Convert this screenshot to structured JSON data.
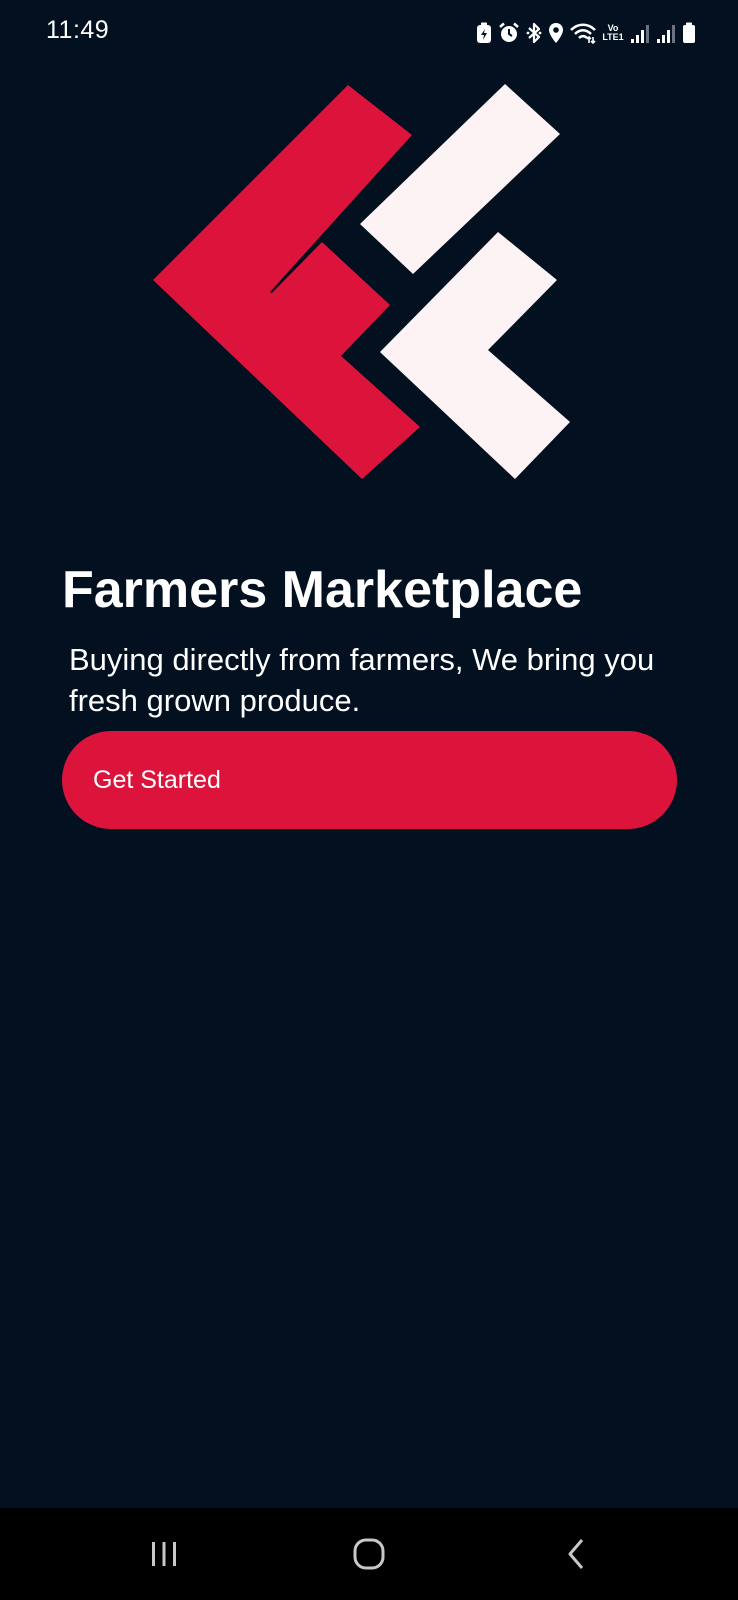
{
  "status_bar": {
    "time": "11:49",
    "network_label": "Vo LTE1",
    "icons": [
      "battery-saver-icon",
      "alarm-icon",
      "bluetooth-icon",
      "location-icon",
      "wifi-icon",
      "signal-icon",
      "signal-icon",
      "battery-icon"
    ]
  },
  "logo": {
    "icon": "farmers-marketplace-logo",
    "colors": {
      "red": "#dc143c",
      "white": "#fdf3f4"
    }
  },
  "main": {
    "title": "Farmers Marketplace",
    "subtitle": "Buying directly from farmers, We bring you fresh grown produce.",
    "cta_label": "Get Started"
  },
  "navigation": {
    "recents_icon": "recents-icon",
    "home_icon": "home-icon",
    "back_icon": "back-icon"
  },
  "colors": {
    "background": "#021020",
    "accent": "#dc143c",
    "nav_background": "#000000"
  }
}
